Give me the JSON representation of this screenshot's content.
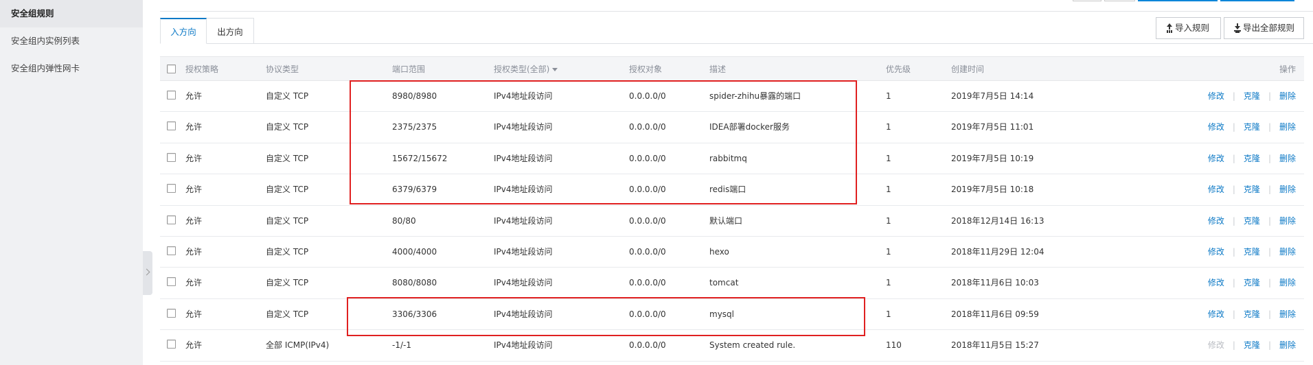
{
  "sidebar": {
    "items": [
      {
        "label": "安全组规则",
        "active": true
      },
      {
        "label": "安全组内实例列表",
        "active": false
      },
      {
        "label": "安全组内弹性网卡",
        "active": false
      }
    ]
  },
  "tabs": [
    {
      "label": "入方向",
      "active": true
    },
    {
      "label": "出方向",
      "active": false
    }
  ],
  "toolbar": {
    "import_label": "导入规则",
    "export_label": "导出全部规则"
  },
  "table": {
    "headers": {
      "policy": "授权策略",
      "protocol": "协议类型",
      "port": "端口范围",
      "auth_type": "授权类型(全部)",
      "auth_object": "授权对象",
      "description": "描述",
      "priority": "优先级",
      "created": "创建时间",
      "actions": "操作"
    },
    "rows": [
      {
        "policy": "允许",
        "protocol": "自定义 TCP",
        "port": "8980/8980",
        "auth_type": "IPv4地址段访问",
        "auth_object": "0.0.0.0/0",
        "description": "spider-zhihu暴露的端口",
        "priority": "1",
        "created": "2019年7月5日 14:14",
        "edit": "修改",
        "clone": "克隆",
        "delete": "删除",
        "edit_disabled": false
      },
      {
        "policy": "允许",
        "protocol": "自定义 TCP",
        "port": "2375/2375",
        "auth_type": "IPv4地址段访问",
        "auth_object": "0.0.0.0/0",
        "description": "IDEA部署docker服务",
        "priority": "1",
        "created": "2019年7月5日 11:01",
        "edit": "修改",
        "clone": "克隆",
        "delete": "删除",
        "edit_disabled": false
      },
      {
        "policy": "允许",
        "protocol": "自定义 TCP",
        "port": "15672/15672",
        "auth_type": "IPv4地址段访问",
        "auth_object": "0.0.0.0/0",
        "description": "rabbitmq",
        "priority": "1",
        "created": "2019年7月5日 10:19",
        "edit": "修改",
        "clone": "克隆",
        "delete": "删除",
        "edit_disabled": false
      },
      {
        "policy": "允许",
        "protocol": "自定义 TCP",
        "port": "6379/6379",
        "auth_type": "IPv4地址段访问",
        "auth_object": "0.0.0.0/0",
        "description": "redis端口",
        "priority": "1",
        "created": "2019年7月5日 10:18",
        "edit": "修改",
        "clone": "克隆",
        "delete": "删除",
        "edit_disabled": false
      },
      {
        "policy": "允许",
        "protocol": "自定义 TCP",
        "port": "80/80",
        "auth_type": "IPv4地址段访问",
        "auth_object": "0.0.0.0/0",
        "description": "默认端口",
        "priority": "1",
        "created": "2018年12月14日 16:13",
        "edit": "修改",
        "clone": "克隆",
        "delete": "删除",
        "edit_disabled": false
      },
      {
        "policy": "允许",
        "protocol": "自定义 TCP",
        "port": "4000/4000",
        "auth_type": "IPv4地址段访问",
        "auth_object": "0.0.0.0/0",
        "description": "hexo",
        "priority": "1",
        "created": "2018年11月29日 12:04",
        "edit": "修改",
        "clone": "克隆",
        "delete": "删除",
        "edit_disabled": false
      },
      {
        "policy": "允许",
        "protocol": "自定义 TCP",
        "port": "8080/8080",
        "auth_type": "IPv4地址段访问",
        "auth_object": "0.0.0.0/0",
        "description": "tomcat",
        "priority": "1",
        "created": "2018年11月6日 10:03",
        "edit": "修改",
        "clone": "克隆",
        "delete": "删除",
        "edit_disabled": false
      },
      {
        "policy": "允许",
        "protocol": "自定义 TCP",
        "port": "3306/3306",
        "auth_type": "IPv4地址段访问",
        "auth_object": "0.0.0.0/0",
        "description": "mysql",
        "priority": "1",
        "created": "2018年11月6日 09:59",
        "edit": "修改",
        "clone": "克隆",
        "delete": "删除",
        "edit_disabled": false
      },
      {
        "policy": "允许",
        "protocol": "全部 ICMP(IPv4)",
        "port": "-1/-1",
        "auth_type": "IPv4地址段访问",
        "auth_object": "0.0.0.0/0",
        "description": "System created rule.",
        "priority": "110",
        "created": "2018年11月5日 15:27",
        "edit": "修改",
        "clone": "克隆",
        "delete": "删除",
        "edit_disabled": true
      }
    ]
  },
  "colors": {
    "accent": "#0c79c6",
    "highlight": "#e02020",
    "disabled_link": "#b9bcc2"
  }
}
